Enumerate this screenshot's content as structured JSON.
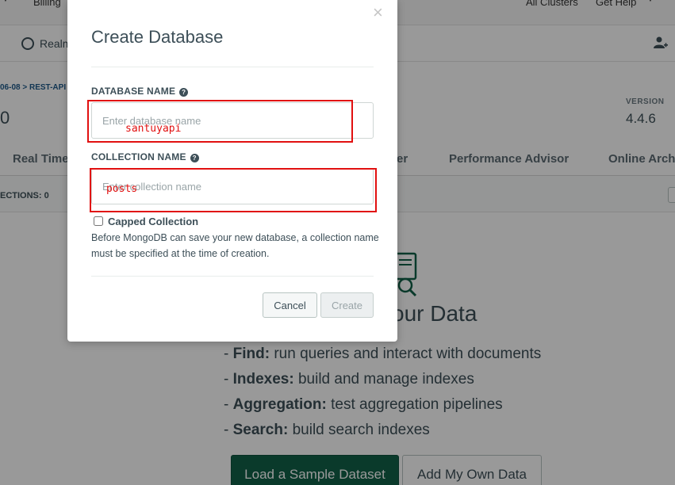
{
  "topbar": {
    "billing": "Billing",
    "all_clusters": "All Clusters",
    "get_help": "Get Help"
  },
  "secondbar": {
    "realm": "Realm"
  },
  "cluster": {
    "breadcrumb": "06-08 > REST-API",
    "name_fragment": "0",
    "version_label": "VERSION",
    "version_value": "4.4.6"
  },
  "tabs": [
    {
      "label": "Real Time"
    },
    {
      "label": "er"
    },
    {
      "label": "Performance Advisor"
    },
    {
      "label": "Online Arch"
    }
  ],
  "collections_bar": {
    "count_label": "ECTIONS: 0"
  },
  "empty_state": {
    "title": "our Data",
    "features": [
      {
        "name": "Find:",
        "desc": " run queries and interact with documents"
      },
      {
        "name": "Indexes:",
        "desc": " build and manage indexes"
      },
      {
        "name": "Aggregation:",
        "desc": " test aggregation pipelines"
      },
      {
        "name": "Search:",
        "desc": " build search indexes"
      }
    ],
    "load_sample_label": "Load a Sample Dataset",
    "add_own_label": "Add My Own Data"
  },
  "modal": {
    "title": "Create Database",
    "close_symbol": "×",
    "database_name_label": "DATABASE NAME",
    "database_name_placeholder": "Enter database name",
    "database_name_value": "",
    "collection_name_label": "COLLECTION NAME",
    "collection_name_placeholder": "Enter collection name",
    "collection_name_value": "",
    "capped_label": "Capped Collection",
    "capped_checked": false,
    "help_text": "Before MongoDB can save your new database, a collection name must be specified at the time of creation.",
    "cancel_label": "Cancel",
    "create_label": "Create"
  },
  "annotations": {
    "database_text": "santuyapi",
    "collection_text": "posts",
    "color": "#e11010"
  },
  "colors": {
    "primary_green": "#116149",
    "text": "#3d4f58",
    "annotation_red": "#e11010"
  }
}
